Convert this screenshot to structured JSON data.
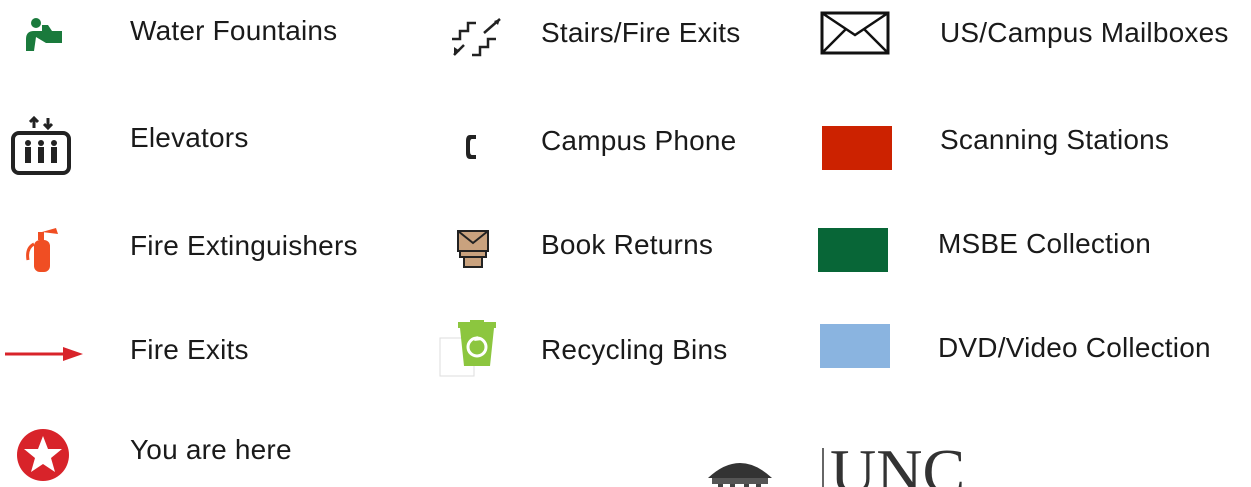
{
  "legend": {
    "col1": [
      {
        "label": "Water Fountains",
        "icon": "water-fountain-icon",
        "color": "#1a7a3c"
      },
      {
        "label": "Elevators",
        "icon": "elevator-icon",
        "color": "#222222"
      },
      {
        "label": "Fire Extinguishers",
        "icon": "fire-extinguisher-icon",
        "color": "#f04e23"
      },
      {
        "label": "Fire Exits",
        "icon": "fire-exit-arrow-icon",
        "color": "#d8232a"
      },
      {
        "label": "You are here",
        "icon": "you-are-here-star-icon",
        "color": "#d8232a"
      }
    ],
    "col2": [
      {
        "label": "Stairs/Fire Exits",
        "icon": "stairs-icon",
        "color": "#222222"
      },
      {
        "label": "Campus Phone",
        "icon": "phone-icon",
        "color": "#222222"
      },
      {
        "label": "Book Returns",
        "icon": "book-return-icon",
        "color": "#c9a27e"
      },
      {
        "label": "Recycling Bins",
        "icon": "recycling-bin-icon",
        "color": "#8cc63f"
      }
    ],
    "col3": [
      {
        "label": "US/Campus Mailboxes",
        "icon": "mailbox-envelope-icon",
        "color": "#111111"
      },
      {
        "label": "Scanning Stations",
        "icon": "scanning-station-swatch",
        "color": "#cc2200"
      },
      {
        "label": "MSBE Collection",
        "icon": "msbe-collection-swatch",
        "color": "#086637"
      },
      {
        "label": "DVD/Video Collection",
        "icon": "dvd-video-collection-swatch",
        "color": "#8ab4e0"
      }
    ]
  },
  "logo": {
    "text": "UNC"
  }
}
